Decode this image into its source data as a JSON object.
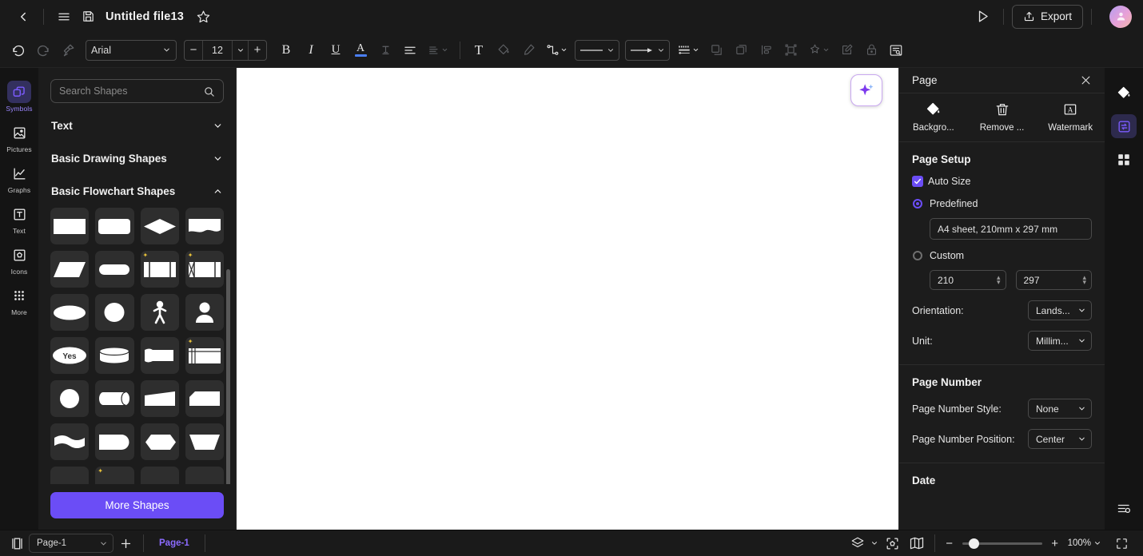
{
  "titlebar": {
    "back_icon": "chevron-left-icon",
    "menu_icon": "hamburger-menu-icon",
    "save_icon": "save-floppy-icon",
    "title": "Untitled file13",
    "favorite_icon": "star-outline-icon",
    "present_icon": "play-triangle-icon",
    "export_label": "Export",
    "export_icon": "upload-icon",
    "avatar_icon": "user-avatar"
  },
  "toolbar": {
    "undo_icon": "undo-icon",
    "redo_icon": "redo-icon",
    "format_painter_icon": "format-painter-icon",
    "font_family": "Arial",
    "font_size": "12",
    "decrease_label": "−",
    "increase_label": "+",
    "bold_label": "B",
    "italic_label": "I",
    "underline_label": "U",
    "font_color_label": "A",
    "font_color_swatch": "#4a7ef5",
    "strikethrough_label": "T",
    "align_icon": "align-left-icon",
    "text_spacing_icon": "line-spacing-icon",
    "text_box_label": "T",
    "fill_icon": "paint-bucket-icon",
    "line_style_icon": "pen-icon",
    "connector_icon": "connector-icon",
    "line_type_icon": "solid-line-icon",
    "arrow_type_icon": "arrow-line-icon",
    "line_weight_icon": "line-weight-icon",
    "shadow_icon": "shadow-icon",
    "duplicate_icon": "copy-layers-icon",
    "align_objects_icon": "align-objects-icon",
    "group_icon": "group-icon",
    "effects_icon": "magic-wand-icon",
    "edit_icon": "edit-pencil-icon",
    "lock_icon": "lock-icon",
    "find_icon": "find-replace-icon"
  },
  "left_rail": {
    "items": [
      {
        "label": "Symbols",
        "icon": "symbols-icon",
        "active": true
      },
      {
        "label": "Pictures",
        "icon": "pictures-icon",
        "active": false
      },
      {
        "label": "Graphs",
        "icon": "graphs-icon",
        "active": false
      },
      {
        "label": "Text",
        "icon": "text-icon",
        "active": false
      },
      {
        "label": "Icons",
        "icon": "icons-icon",
        "active": false
      },
      {
        "label": "More",
        "icon": "more-grid-icon",
        "active": false
      }
    ]
  },
  "shapes_panel": {
    "search_placeholder": "Search Shapes",
    "search_value": "",
    "search_icon": "search-icon",
    "sections": [
      {
        "label": "Text",
        "expanded": false
      },
      {
        "label": "Basic Drawing Shapes",
        "expanded": false
      },
      {
        "label": "Basic Flowchart Shapes",
        "expanded": true
      }
    ],
    "more_shapes_label": "More Shapes",
    "shape_rows": [
      [
        "process",
        "rounded-process",
        "decision",
        "document"
      ],
      [
        "data-parallelogram",
        "terminator",
        "predefined-process",
        "internal-storage"
      ],
      [
        "ellipse-connector",
        "circle",
        "manual-operation-person",
        "user-person"
      ],
      [
        "yes-decision",
        "stored-data-cylinder",
        "tape-data",
        "multi-document"
      ],
      [
        "circle-connector",
        "direct-access-storage",
        "manual-input",
        "card"
      ],
      [
        "paper-tape",
        "delay",
        "preparation-hexagon",
        "extract-trapezoid"
      ]
    ]
  },
  "canvas": {
    "ai_button_icon": "ai-sparkle-icon",
    "background": "#ffffff"
  },
  "page_panel": {
    "title": "Page",
    "close_icon": "close-x-icon",
    "actions": [
      {
        "label": "Backgro...",
        "icon": "paint-bucket-icon"
      },
      {
        "label": "Remove ...",
        "icon": "trash-icon"
      },
      {
        "label": "Watermark",
        "icon": "watermark-icon"
      }
    ],
    "page_setup": {
      "heading": "Page Setup",
      "auto_size_label": "Auto Size",
      "auto_size_checked": true,
      "predefined_label": "Predefined",
      "predefined_selected": true,
      "predefined_value": "A4 sheet, 210mm x 297 mm",
      "custom_label": "Custom",
      "custom_selected": false,
      "width_value": "210",
      "height_value": "297",
      "orientation_label": "Orientation:",
      "orientation_value": "Lands...",
      "unit_label": "Unit:",
      "unit_value": "Millim..."
    },
    "page_number": {
      "heading": "Page Number",
      "style_label": "Page Number Style:",
      "style_value": "None",
      "position_label": "Page Number Position:",
      "position_value": "Center"
    },
    "date": {
      "heading": "Date"
    }
  },
  "right_rail": {
    "items": [
      {
        "icon": "paint-bucket-icon",
        "active": false
      },
      {
        "icon": "page-swap-icon",
        "active": true
      },
      {
        "icon": "grid-four-icon",
        "active": false
      }
    ],
    "bottom_item": {
      "icon": "settings-sliders-icon"
    }
  },
  "statusbar": {
    "pages_icon": "page-panel-toggle-icon",
    "page_select_value": "Page-1",
    "add_page_label": "+",
    "page_tab_label": "Page-1",
    "layers_icon": "layers-icon",
    "focus_icon": "focus-icon",
    "map_icon": "map-overview-icon",
    "zoom_minus": "−",
    "zoom_plus": "+",
    "zoom_value": "100%",
    "zoom_percent": 100,
    "fullscreen_icon": "fullscreen-icon"
  },
  "colors": {
    "accent": "#6b4df6",
    "panel_bg": "#1c1c1c",
    "rail_bg": "#141414",
    "canvas_bg": "#ffffff",
    "page_tab_text": "#8b6bff"
  }
}
